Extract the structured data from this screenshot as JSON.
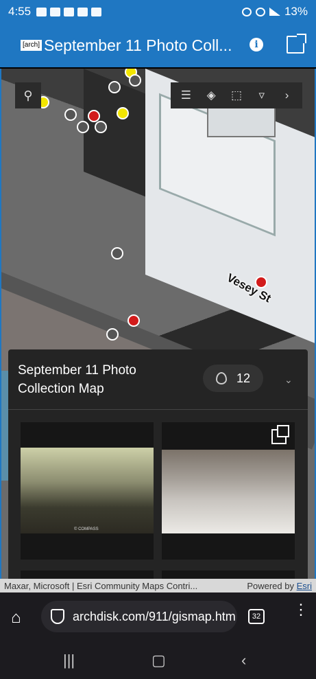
{
  "status_bar": {
    "time": "4:55",
    "battery": "13%"
  },
  "header": {
    "logo_text": "[arch]",
    "title": "September 11 Photo Coll...",
    "info_icon": "info-icon",
    "share_icon": "share-icon"
  },
  "map": {
    "street_label": "Vesey St",
    "attribution": "Maxar, Microsoft | Esri Community Maps Contri...",
    "powered_by": "Powered by",
    "esri_link": "Esri"
  },
  "panel": {
    "title": "September 11 Photo Collection Map",
    "count": "12",
    "card1_copyright": "© COMPASS"
  },
  "browser": {
    "url": "archdisk.com/911/gismap.htm",
    "tabs_count": "32"
  },
  "colors": {
    "accent": "#1f77c2",
    "marker_red": "#d21b1b",
    "marker_yellow": "#f3e600"
  }
}
